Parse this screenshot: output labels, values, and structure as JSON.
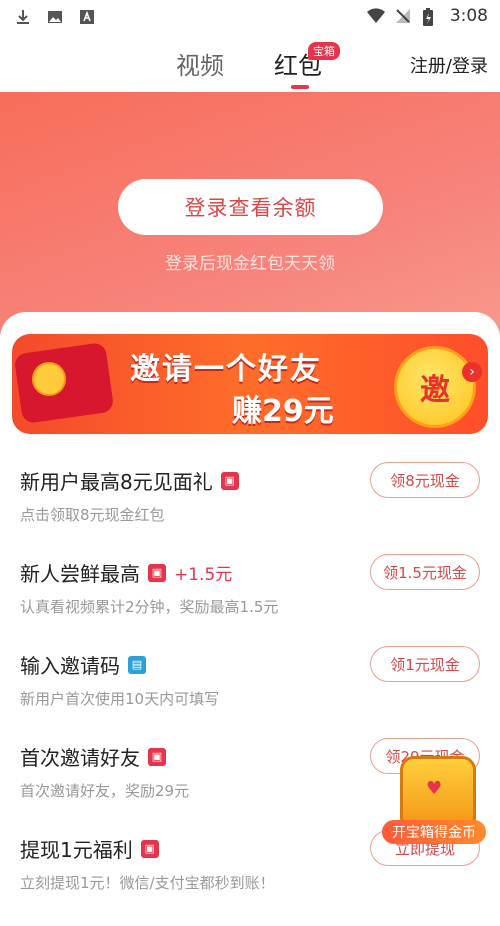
{
  "status": {
    "time": "3:08"
  },
  "nav": {
    "tabs": [
      {
        "label": "视频"
      },
      {
        "label": "红包"
      }
    ],
    "badge": "宝箱",
    "register_login": "注册/登录"
  },
  "hero": {
    "login_button": "登录查看余额",
    "subtitle": "登录后现金红包天天领"
  },
  "banner": {
    "title": "邀请一个好友",
    "subtitle": "赚29元",
    "invite_label": "邀"
  },
  "tasks": [
    {
      "title": "新用户最高8元见面礼",
      "icon": "gift-icon",
      "bonus": "",
      "desc": "点击领取8元现金红包",
      "button": "领8元现金"
    },
    {
      "title": "新人尝鲜最高",
      "icon": "gift-icon",
      "bonus": "+1.5元",
      "desc": "认真看视频累计2分钟，奖励最高1.5元",
      "button": "领1.5元现金"
    },
    {
      "title": "输入邀请码",
      "icon": "code-icon",
      "bonus": "",
      "desc": "新用户首次使用10天内可填写",
      "button": "领1元现金"
    },
    {
      "title": "首次邀请好友",
      "icon": "gift-icon",
      "bonus": "",
      "desc": "首次邀请好友，奖励29元",
      "button": "领29元现金"
    },
    {
      "title": "提现1元福利",
      "icon": "gift-icon",
      "bonus": "",
      "desc": "立刻提现1元！微信/支付宝都秒到账！",
      "button": "立即提现"
    }
  ],
  "chest": {
    "label": "开宝箱得金币"
  },
  "colors": {
    "accent": "#e8344a",
    "hero": "#f86d5a"
  }
}
